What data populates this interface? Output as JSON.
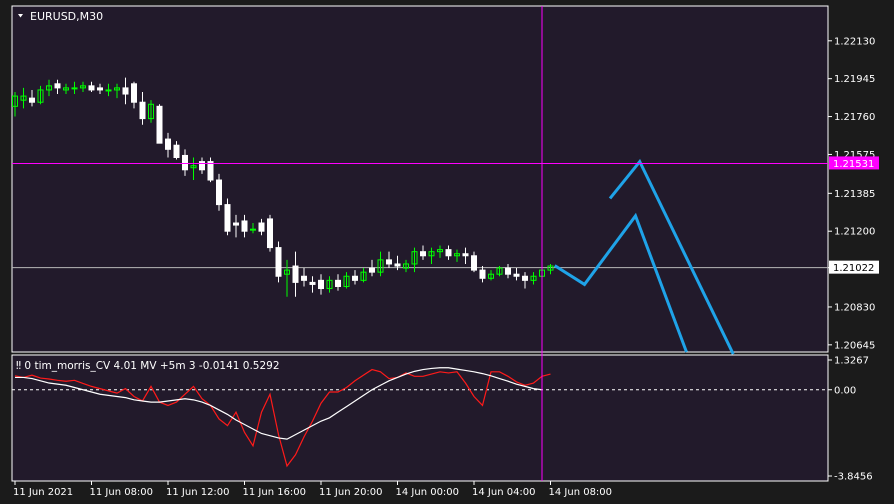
{
  "symbol_label": "EURUSD,M30",
  "colors": {
    "background": "#221a2b",
    "frame": "#ffffff",
    "bull": "#00ff00",
    "bear": "#ffffff",
    "crosshair": "#ff00ff",
    "price_marker": "#ff00ff",
    "projection": "#1fa3e8",
    "indicator_red": "#ff1a1a",
    "indicator_white": "#ffffff"
  },
  "price_axis": {
    "labels": [
      "1.22130",
      "1.21945",
      "1.21760",
      "1.21575",
      "1.21385",
      "1.21200",
      "1.21022",
      "1.20830",
      "1.20645"
    ],
    "range": [
      1.2061,
      1.223
    ]
  },
  "crosshair": {
    "price_label": "1.21531",
    "price": 1.21531,
    "time_index": 62
  },
  "reference_line": {
    "price_label": "1.21022",
    "price": 1.21022
  },
  "indicator": {
    "label": "‼ 0 tim_morris_CV 4.01 MV +5m 3 -0.0141 0.5292",
    "axis_labels": [
      "1.3267",
      "0.00",
      "-3.8456"
    ],
    "max": 1.3267,
    "min": -3.8456,
    "red_series": [
      0.62,
      0.55,
      0.65,
      0.52,
      0.48,
      0.42,
      0.38,
      0.42,
      0.28,
      0.15,
      0.05,
      -0.05,
      -0.15,
      0.05,
      -0.3,
      -0.5,
      0.15,
      -0.55,
      -0.7,
      -0.55,
      -0.2,
      0.15,
      -0.4,
      -0.7,
      -1.3,
      -1.6,
      -1.0,
      -1.9,
      -2.5,
      -1.0,
      -0.2,
      -2.0,
      -3.4,
      -2.9,
      -2.1,
      -1.4,
      -0.6,
      -0.1,
      -0.1,
      0.1,
      0.4,
      0.65,
      0.9,
      0.8,
      0.5,
      0.55,
      0.75,
      0.6,
      0.6,
      0.7,
      0.8,
      0.75,
      0.8,
      0.3,
      -0.3,
      -0.7,
      0.8,
      0.8,
      0.6,
      0.35,
      0.2,
      0.3,
      0.6,
      0.7
    ],
    "white_series": [
      0.55,
      0.55,
      0.5,
      0.4,
      0.3,
      0.25,
      0.2,
      0.1,
      0.0,
      -0.1,
      -0.2,
      -0.25,
      -0.3,
      -0.35,
      -0.45,
      -0.5,
      -0.55,
      -0.55,
      -0.5,
      -0.45,
      -0.4,
      -0.45,
      -0.55,
      -0.7,
      -0.9,
      -1.1,
      -1.35,
      -1.55,
      -1.75,
      -1.95,
      -2.05,
      -2.15,
      -2.2,
      -2.0,
      -1.8,
      -1.6,
      -1.4,
      -1.25,
      -1.0,
      -0.75,
      -0.5,
      -0.25,
      0.0,
      0.2,
      0.4,
      0.55,
      0.7,
      0.82,
      0.9,
      0.95,
      0.98,
      0.98,
      0.92,
      0.86,
      0.8,
      0.72,
      0.62,
      0.5,
      0.38,
      0.25,
      0.15,
      0.05,
      0.0
    ]
  },
  "time_axis": {
    "labels": [
      {
        "text": "11 Jun 2021",
        "index": 0
      },
      {
        "text": "11 Jun 08:00",
        "index": 9
      },
      {
        "text": "11 Jun 12:00",
        "index": 18
      },
      {
        "text": "11 Jun 16:00",
        "index": 27
      },
      {
        "text": "11 Jun 20:00",
        "index": 36
      },
      {
        "text": "14 Jun 00:00",
        "index": 45
      },
      {
        "text": "14 Jun 04:00",
        "index": 54
      },
      {
        "text": "14 Jun 08:00",
        "index": 63
      }
    ]
  },
  "chart_data": {
    "type": "candlestick",
    "ylim": [
      1.2061,
      1.223
    ],
    "candles": [
      [
        1.2181,
        1.2188,
        1.2176,
        1.2186
      ],
      [
        1.2184,
        1.219,
        1.218,
        1.2186
      ],
      [
        1.2185,
        1.2189,
        1.2181,
        1.2183
      ],
      [
        1.2183,
        1.2191,
        1.2182,
        1.2189
      ],
      [
        1.2189,
        1.2194,
        1.2186,
        1.2191
      ],
      [
        1.2192,
        1.2194,
        1.2187,
        1.219
      ],
      [
        1.2189,
        1.2192,
        1.2187,
        1.219
      ],
      [
        1.219,
        1.2193,
        1.2187,
        1.219
      ],
      [
        1.219,
        1.2193,
        1.2188,
        1.2191
      ],
      [
        1.2191,
        1.2193,
        1.2188,
        1.2189
      ],
      [
        1.219,
        1.2192,
        1.2187,
        1.2189
      ],
      [
        1.2189,
        1.2192,
        1.2186,
        1.2189
      ],
      [
        1.2189,
        1.2192,
        1.2185,
        1.219
      ],
      [
        1.219,
        1.2195,
        1.2182,
        1.2187
      ],
      [
        1.2192,
        1.2193,
        1.218,
        1.2183
      ],
      [
        1.2183,
        1.2188,
        1.2172,
        1.2175
      ],
      [
        1.2175,
        1.2184,
        1.2173,
        1.2182
      ],
      [
        1.2181,
        1.2182,
        1.217,
        1.2163
      ],
      [
        1.2165,
        1.2168,
        1.2156,
        1.216
      ],
      [
        1.2162,
        1.2164,
        1.2155,
        1.2156
      ],
      [
        1.2157,
        1.216,
        1.2147,
        1.215
      ],
      [
        1.2151,
        1.2156,
        1.2145,
        1.2152
      ],
      [
        1.2154,
        1.2156,
        1.2148,
        1.215
      ],
      [
        1.2154,
        1.2156,
        1.2144,
        1.2145
      ],
      [
        1.2145,
        1.2148,
        1.213,
        1.2133
      ],
      [
        1.2133,
        1.2136,
        1.2118,
        1.212
      ],
      [
        1.2124,
        1.2128,
        1.2117,
        1.2123
      ],
      [
        1.2125,
        1.2128,
        1.2117,
        1.212
      ],
      [
        1.2121,
        1.2124,
        1.2119,
        1.2121
      ],
      [
        1.2124,
        1.2126,
        1.2118,
        1.212
      ],
      [
        1.2126,
        1.2128,
        1.211,
        1.2112
      ],
      [
        1.2112,
        1.2115,
        1.2095,
        1.2098
      ],
      [
        1.2099,
        1.2106,
        1.2088,
        1.2101
      ],
      [
        1.2103,
        1.211,
        1.2088,
        1.2095
      ],
      [
        1.2098,
        1.2102,
        1.2093,
        1.2096
      ],
      [
        1.2095,
        1.2098,
        1.209,
        1.2094
      ],
      [
        1.2096,
        1.2099,
        1.2089,
        1.2092
      ],
      [
        1.2092,
        1.2098,
        1.209,
        1.2096
      ],
      [
        1.2096,
        1.2099,
        1.2091,
        1.2093
      ],
      [
        1.2093,
        1.21,
        1.2092,
        1.2098
      ],
      [
        1.2098,
        1.2101,
        1.2094,
        1.2096
      ],
      [
        1.2096,
        1.2102,
        1.2095,
        1.21
      ],
      [
        1.2102,
        1.2106,
        1.2098,
        1.21
      ],
      [
        1.21,
        1.211,
        1.2098,
        1.2106
      ],
      [
        1.2106,
        1.211,
        1.2102,
        1.2104
      ],
      [
        1.2104,
        1.2108,
        1.2101,
        1.2103
      ],
      [
        1.2102,
        1.2106,
        1.21,
        1.2104
      ],
      [
        1.2104,
        1.2112,
        1.21,
        1.211
      ],
      [
        1.211,
        1.2113,
        1.2106,
        1.2108
      ],
      [
        1.2108,
        1.2112,
        1.2104,
        1.211
      ],
      [
        1.211,
        1.2113,
        1.2107,
        1.2111
      ],
      [
        1.2111,
        1.2113,
        1.2106,
        1.2108
      ],
      [
        1.2108,
        1.2111,
        1.2105,
        1.2109
      ],
      [
        1.2109,
        1.2112,
        1.2104,
        1.2108
      ],
      [
        1.2108,
        1.211,
        1.21,
        1.2101
      ],
      [
        1.2101,
        1.2103,
        1.2095,
        1.2097
      ],
      [
        1.2097,
        1.2101,
        1.2096,
        1.2099
      ],
      [
        1.2099,
        1.2103,
        1.2098,
        1.2102
      ],
      [
        1.2102,
        1.2104,
        1.2097,
        1.2099
      ],
      [
        1.2099,
        1.2102,
        1.2096,
        1.2098
      ],
      [
        1.2098,
        1.21,
        1.2092,
        1.2096
      ],
      [
        1.2096,
        1.21,
        1.2094,
        1.2098
      ],
      [
        1.2098,
        1.2103,
        1.2095,
        1.2101
      ],
      [
        1.2101,
        1.2104,
        1.2099,
        1.2103
      ]
    ],
    "projection": [
      [
        [
          63.5,
          1.21032
        ],
        [
          67,
          1.2094
        ],
        [
          73,
          1.21275
        ],
        [
          79,
          1.2061
        ]
      ],
      [
        [
          70,
          1.2136
        ],
        [
          73.5,
          1.2154
        ],
        [
          84.5,
          1.206
        ]
      ]
    ]
  }
}
